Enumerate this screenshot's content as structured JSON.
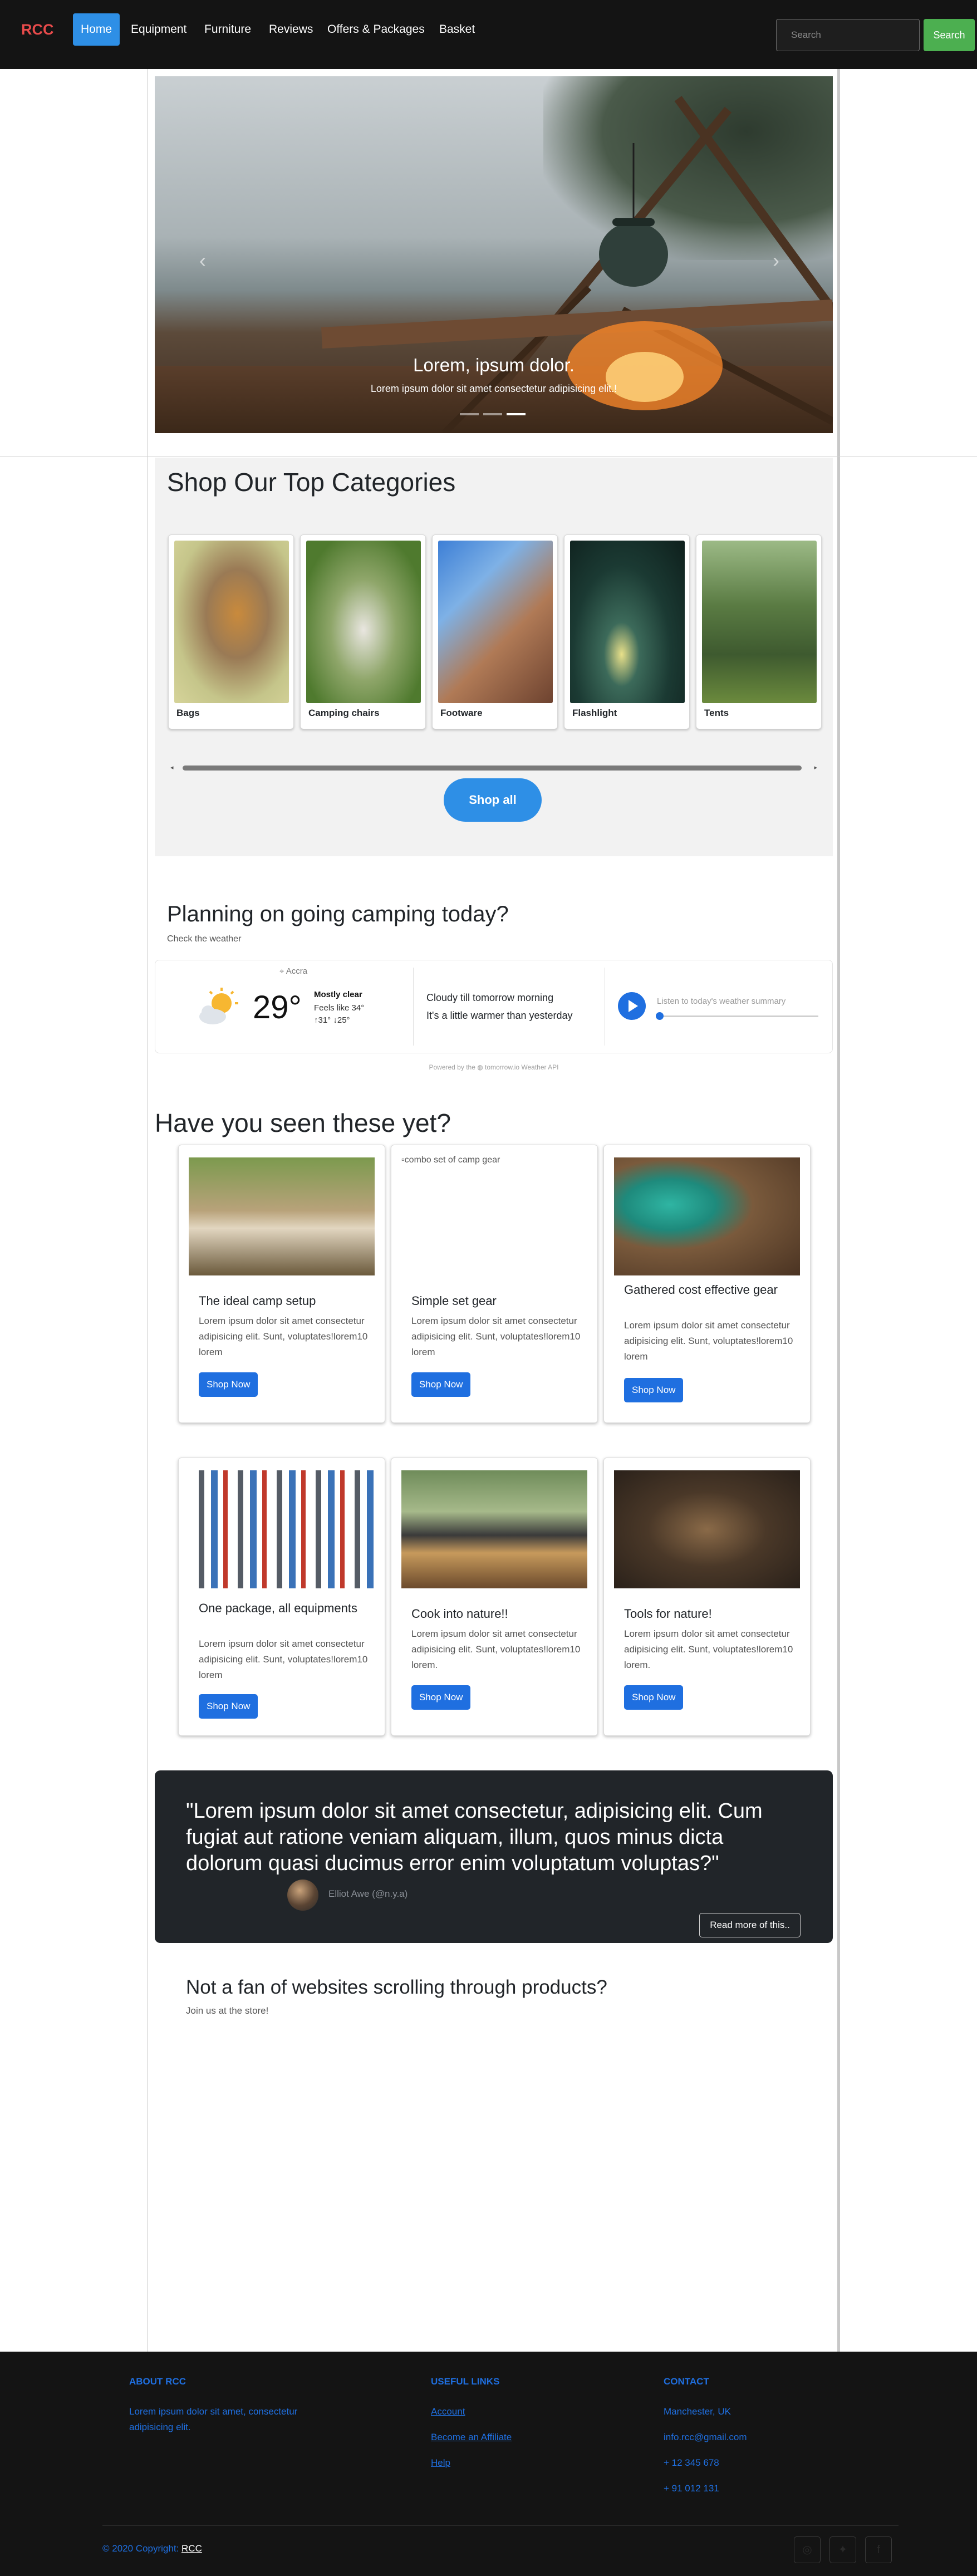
{
  "nav": {
    "brand": "RCC",
    "items": [
      "Home",
      "Equipment",
      "Furniture",
      "Reviews",
      "Offers & Packages",
      "Basket"
    ],
    "search_placeholder": "Search",
    "search_button": "Search"
  },
  "hero": {
    "title": "Lorem, ipsum dolor.",
    "subtitle": "Lorem ipsum dolor sit amet consectetur adipisicing elit.!"
  },
  "categories": {
    "title": "Shop Our Top Categories",
    "items": [
      "Bags",
      "Camping chairs",
      "Footware",
      "Flashlight",
      "Tents"
    ],
    "shop_all": "Shop all"
  },
  "weather": {
    "title": "Planning on going camping today?",
    "subtitle": "Check the weather",
    "location": "Accra",
    "temperature": "29°",
    "condition": "Mostly clear",
    "feels_like": "Feels like 34°",
    "range": "↑31°  ↓25°",
    "summary_line1": "Cloudy till tomorrow morning",
    "summary_line2": "It's a little warmer than yesterday",
    "listen": "Listen to today's weather summary",
    "powered": "Powered by the ◍ tomorrow.io Weather API",
    "colors": {
      "accent": "#1f6fe0"
    }
  },
  "products": {
    "title": "Have you seen these yet?",
    "items": [
      {
        "name": "The ideal camp setup",
        "desc": "Lorem ipsum dolor sit amet consectetur adipisicing elit. Sunt, voluptates!lorem10 lorem",
        "button": "Shop Now"
      },
      {
        "name": "Simple set gear",
        "desc": "Lorem ipsum dolor sit amet consectetur adipisicing elit. Sunt, voluptates!lorem10 lorem",
        "button": "Shop Now",
        "alt": "combo set of camp gear"
      },
      {
        "name": "Gathered cost effective gear",
        "desc": "Lorem ipsum dolor sit amet consectetur adipisicing elit. Sunt, voluptates!lorem10 lorem",
        "button": "Shop Now"
      },
      {
        "name": "One package, all equipments",
        "desc": "Lorem ipsum dolor sit amet consectetur adipisicing elit. Sunt, voluptates!lorem10 lorem",
        "button": "Shop Now"
      },
      {
        "name": "Cook into nature!!",
        "desc": "Lorem ipsum dolor sit amet consectetur adipisicing elit. Sunt, voluptates!lorem10 lorem.",
        "button": "Shop Now"
      },
      {
        "name": "Tools for nature!",
        "desc": "Lorem ipsum dolor sit amet consectetur adipisicing elit. Sunt, voluptates!lorem10 lorem.",
        "button": "Shop Now"
      }
    ]
  },
  "quote": {
    "text": "\"Lorem ipsum dolor sit amet consectetur, adipisicing elit. Cum fugiat aut ratione veniam aliquam, illum, quos minus dicta dolorum quasi ducimus error enim voluptatum voluptas?\"",
    "author": "Elliot Awe (@n.y.a)",
    "more": "Read more of this.."
  },
  "store": {
    "title": "Not a fan of websites scrolling through products?",
    "subtitle": "Join us at the store!"
  },
  "footer": {
    "about_head": "ABOUT RCC",
    "about_text": "Lorem ipsum dolor sit amet, consectetur adipisicing elit.",
    "links_head": "USEFUL LINKS",
    "links": [
      "Account",
      "Become an Affiliate",
      "Help"
    ],
    "contact_head": "CONTACT",
    "contact": [
      "Manchester, UK",
      "info.rcc@gmail.com",
      "+ 12 345 678",
      "+ 91 012 131"
    ],
    "copyright": "© 2020 Copyright:",
    "copyright_link": "RCC"
  }
}
